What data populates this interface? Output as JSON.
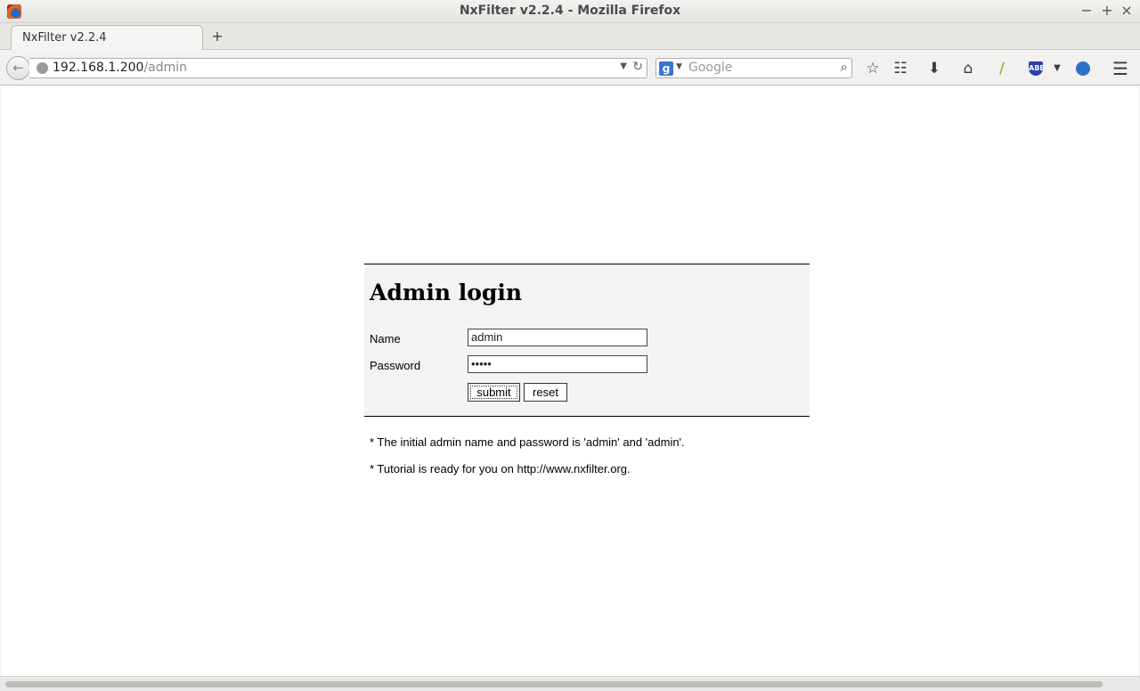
{
  "window": {
    "title": "NxFilter v2.2.4 - Mozilla Firefox",
    "minimize": "−",
    "maximize": "+",
    "close": "×"
  },
  "tabs": [
    {
      "label": "NxFilter v2.2.4"
    }
  ],
  "new_tab_label": "+",
  "navbar": {
    "url_host": "192.168.1.200",
    "url_path": "/admin",
    "search_placeholder": "Google",
    "search_engine_icon": "google-icon",
    "toolbar_icons": [
      "bookmark-star-icon",
      "reading-list-icon",
      "downloads-icon",
      "home-icon",
      "leaf-addon-icon",
      "abe-addon-icon",
      "addon-dropdown-icon",
      "sync-icon",
      "menu-icon"
    ]
  },
  "login": {
    "title": "Admin login",
    "name_label": "Name",
    "name_value": "admin",
    "password_label": "Password",
    "password_value": "•••••",
    "submit_label": "submit",
    "reset_label": "reset"
  },
  "notes": [
    "* The initial admin name and password is 'admin' and 'admin'.",
    "* Tutorial is ready for you on http://www.nxfilter.org."
  ]
}
